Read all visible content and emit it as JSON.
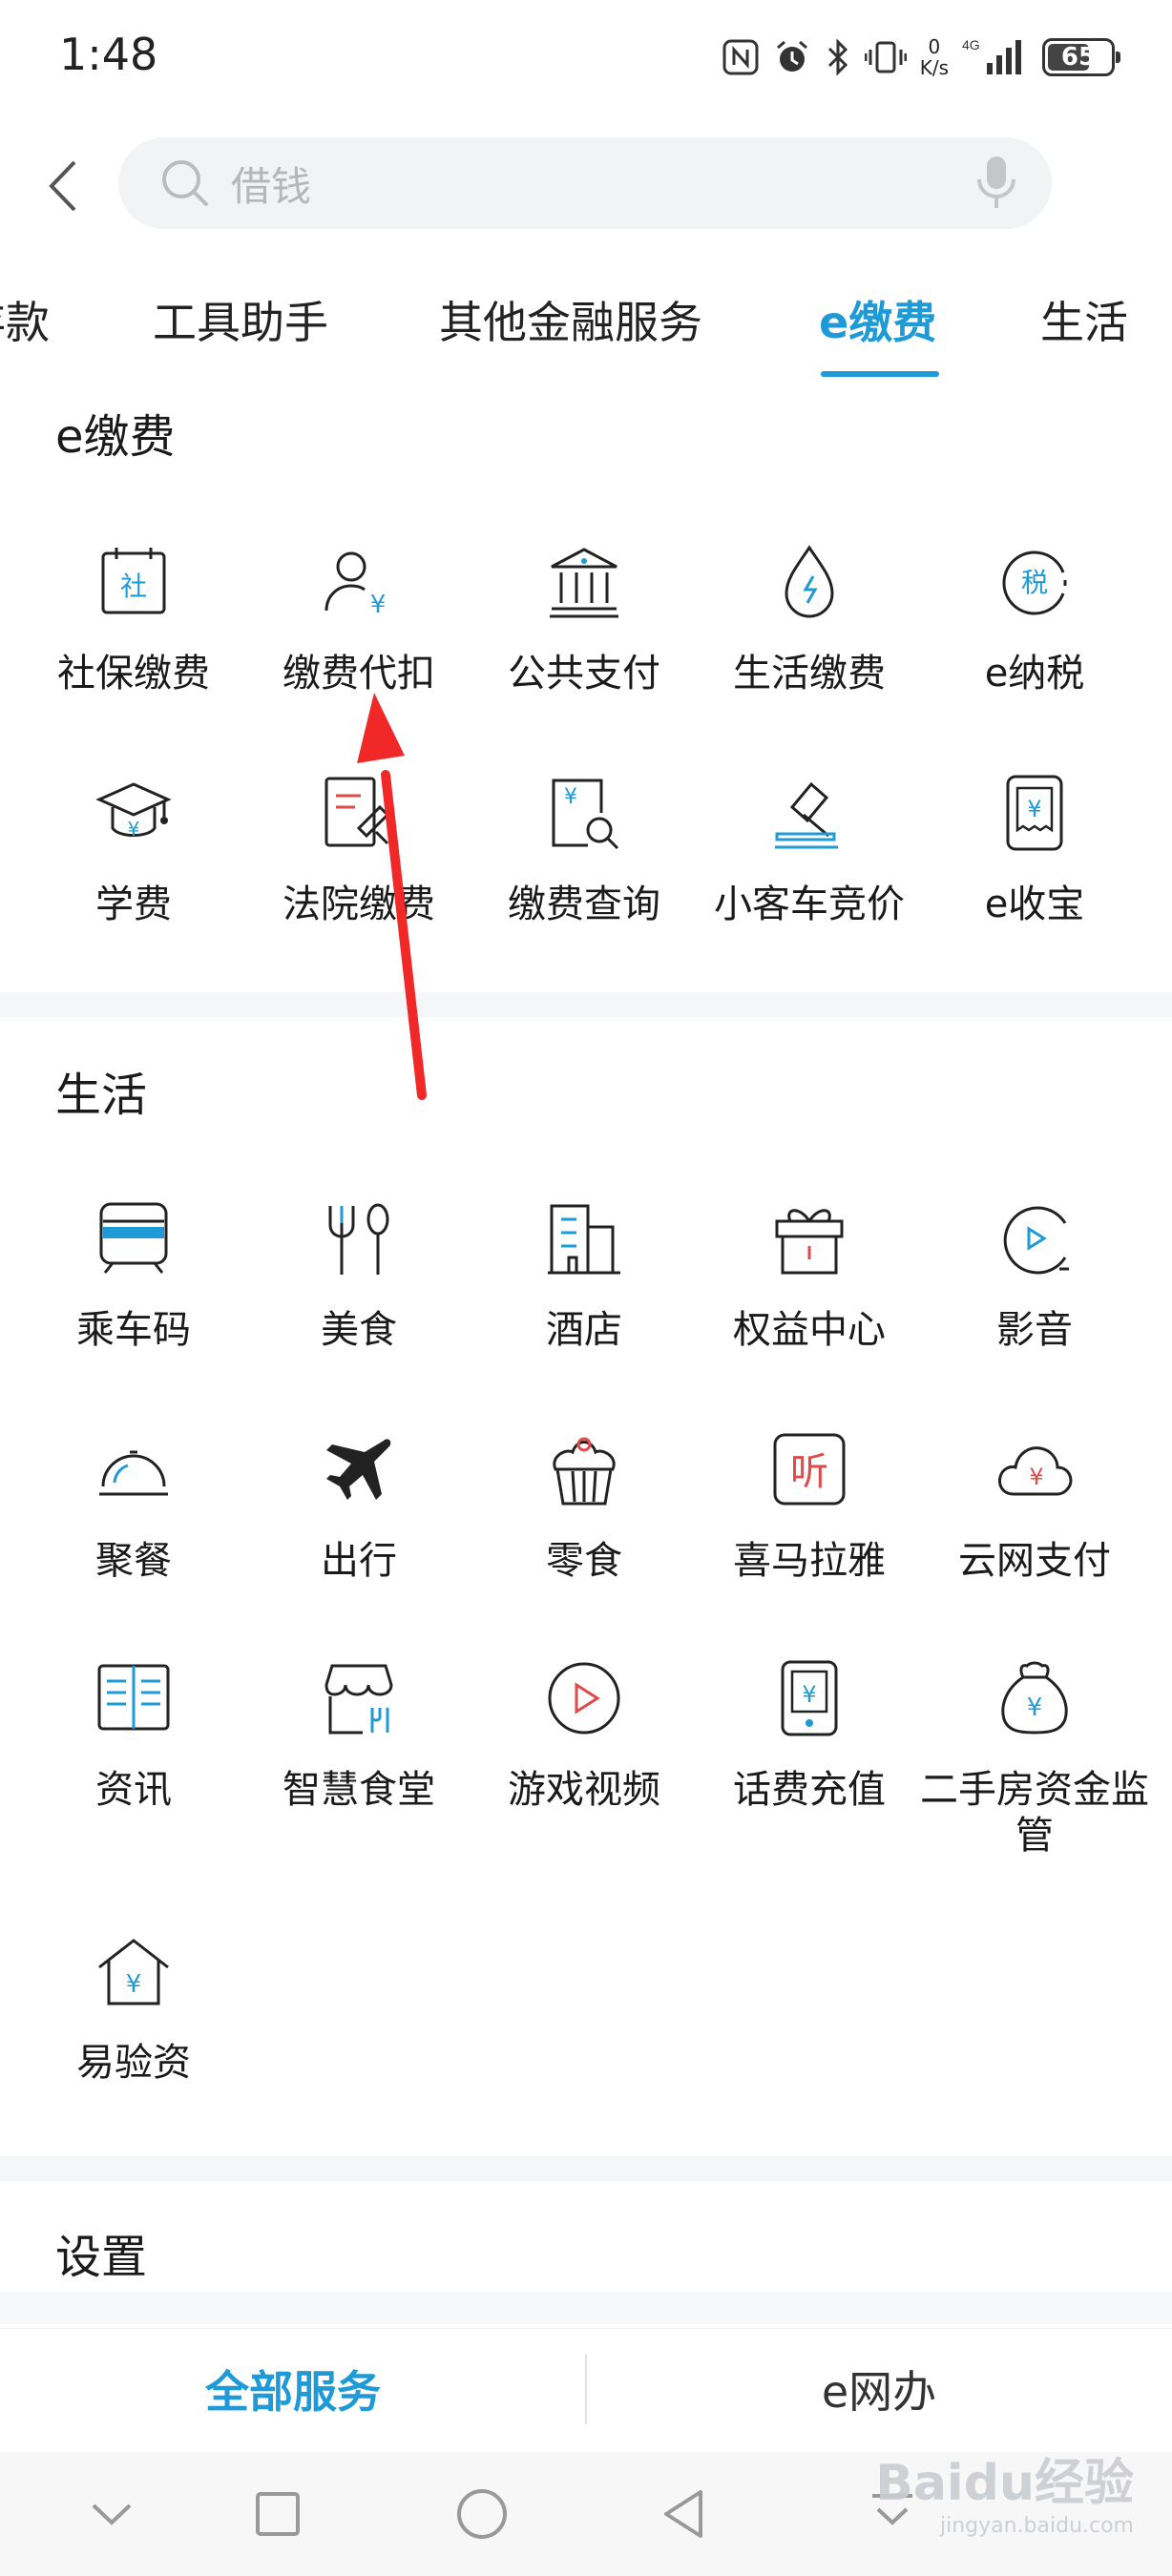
{
  "status_bar": {
    "time": "1:48",
    "net_speed_top": "0",
    "net_speed_bottom": "K/s",
    "signal": "4G",
    "battery": "65"
  },
  "search": {
    "placeholder": "借钱"
  },
  "tabs": [
    {
      "label": "存款"
    },
    {
      "label": "工具助手"
    },
    {
      "label": "其他金融服务"
    },
    {
      "label": "e缴费"
    },
    {
      "label": "生活"
    }
  ],
  "section_efee": {
    "title": "e缴费",
    "items": [
      {
        "label": "社保缴费",
        "icon": "social-security-icon"
      },
      {
        "label": "缴费代扣",
        "icon": "user-yuan-icon"
      },
      {
        "label": "公共支付",
        "icon": "bank-building-icon"
      },
      {
        "label": "生活缴费",
        "icon": "water-drop-icon"
      },
      {
        "label": "e纳税",
        "icon": "tax-icon"
      },
      {
        "label": "学费",
        "icon": "graduation-cap-icon"
      },
      {
        "label": "法院缴费",
        "icon": "court-document-icon"
      },
      {
        "label": "缴费查询",
        "icon": "bill-search-icon"
      },
      {
        "label": "小客车竞价",
        "icon": "auction-gavel-icon"
      },
      {
        "label": "e收宝",
        "icon": "receipt-phone-icon"
      }
    ]
  },
  "section_life": {
    "title": "生活",
    "items": [
      {
        "label": "乘车码",
        "icon": "train-icon"
      },
      {
        "label": "美食",
        "icon": "fork-spoon-icon"
      },
      {
        "label": "酒店",
        "icon": "hotel-icon"
      },
      {
        "label": "权益中心",
        "icon": "gift-icon"
      },
      {
        "label": "影音",
        "icon": "play-circle-icon"
      },
      {
        "label": "聚餐",
        "icon": "dish-cover-icon"
      },
      {
        "label": "出行",
        "icon": "airplane-icon"
      },
      {
        "label": "零食",
        "icon": "cupcake-icon"
      },
      {
        "label": "喜马拉雅",
        "icon": "listen-icon"
      },
      {
        "label": "云网支付",
        "icon": "cloud-yuan-icon"
      },
      {
        "label": "资讯",
        "icon": "book-icon"
      },
      {
        "label": "智慧食堂",
        "icon": "canteen-icon"
      },
      {
        "label": "游戏视频",
        "icon": "play-button-icon"
      },
      {
        "label": "话费充值",
        "icon": "phone-yuan-icon"
      },
      {
        "label": "二手房资金监管",
        "icon": "money-bag-icon"
      },
      {
        "label": "易验资",
        "icon": "house-yuan-icon"
      }
    ]
  },
  "section_settings": {
    "title": "设置"
  },
  "bottom_tabs": {
    "all_services": "全部服务",
    "e_office": "e网办"
  },
  "watermark": {
    "brand": "Baidu经验",
    "sub": "jingyan.baidu.com"
  },
  "colors": {
    "accent": "#1e9ad6",
    "icon_red": "#e04a4a"
  }
}
